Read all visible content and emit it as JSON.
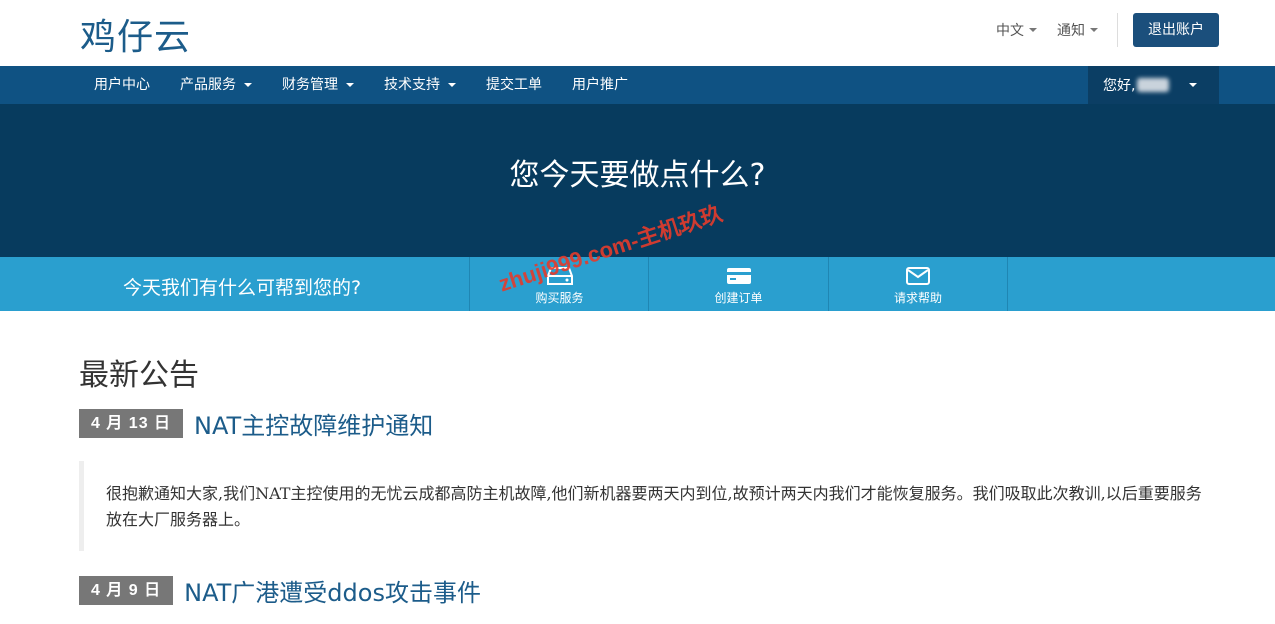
{
  "header": {
    "logo": "鸡仔云",
    "language_label": "中文",
    "notifications_label": "通知",
    "logout_label": "退出账户"
  },
  "nav": {
    "items": [
      {
        "label": "用户中心",
        "dropdown": false
      },
      {
        "label": "产品服务",
        "dropdown": true
      },
      {
        "label": "财务管理",
        "dropdown": true
      },
      {
        "label": "技术支持",
        "dropdown": true
      },
      {
        "label": "提交工单",
        "dropdown": false
      },
      {
        "label": "用户推广",
        "dropdown": false
      }
    ],
    "user_greeting": "您好,"
  },
  "hero": {
    "title": "您今天要做点什么?"
  },
  "helpbar": {
    "text": "今天我们有什么可帮到您的?",
    "actions": [
      {
        "label": "购买服务",
        "icon": "server-icon"
      },
      {
        "label": "创建订单",
        "icon": "credit-card-icon"
      },
      {
        "label": "请求帮助",
        "icon": "envelope-icon"
      }
    ]
  },
  "watermark": "zhuji999.com-主机玖玖",
  "announcements": {
    "heading": "最新公告",
    "items": [
      {
        "date": "4 月 13 日",
        "title": "NAT主控故障维护通知",
        "body": "很抱歉通知大家,我们NAT主控使用的无忧云成都高防主机故障,他们新机器要两天内到位,故预计两天内我们才能恢复服务。我们吸取此次教训,以后重要服务放在大厂服务器上。"
      },
      {
        "date": "4 月 9 日",
        "title": "NAT广港遭受ddos攻击事件"
      }
    ]
  },
  "colors": {
    "nav_bg": "#0f5283",
    "hero_bg": "#073b5e",
    "helpbar_bg": "#2a9fcf",
    "accent": "#1c5c8a"
  }
}
